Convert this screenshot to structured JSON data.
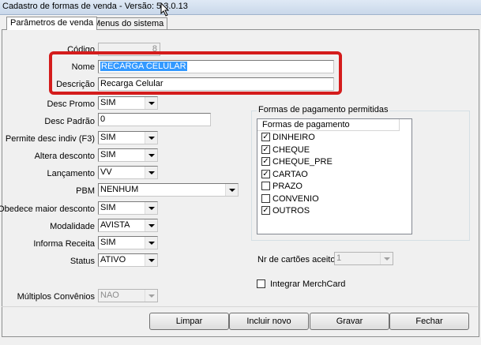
{
  "window": {
    "title": "Cadastro de formas de venda - Versão: 5.3.0.13"
  },
  "tabs": [
    {
      "label": "Parâmetros de venda",
      "active": true
    },
    {
      "label": "Menus do sistema",
      "active": false
    }
  ],
  "form": {
    "codigo": {
      "label": "Código",
      "value": "8"
    },
    "nome": {
      "label": "Nome",
      "value": "RECARGA CELULAR"
    },
    "descricao": {
      "label": "Descrição",
      "value": "Recarga Celular"
    },
    "desc_promo": {
      "label": "Desc Promo",
      "value": "SIM"
    },
    "desc_padrao": {
      "label": "Desc Padrão",
      "value": "0"
    },
    "permite_desc_indiv": {
      "label": "Permite desc indiv (F3)",
      "value": "SIM"
    },
    "altera_desconto": {
      "label": "Altera desconto",
      "value": "SIM"
    },
    "lancamento": {
      "label": "Lançamento",
      "value": "VV"
    },
    "pbm": {
      "label": "PBM",
      "value": "NENHUM"
    },
    "obedece_maior_desconto": {
      "label": "Obedece maior desconto",
      "value": "SIM"
    },
    "modalidade": {
      "label": "Modalidade",
      "value": "AVISTA"
    },
    "informa_receita": {
      "label": "Informa Receita",
      "value": "SIM"
    },
    "status": {
      "label": "Status",
      "value": "ATIVO"
    },
    "multiplos_convenios": {
      "label": "Múltiplos Convênios",
      "value": "NAO"
    }
  },
  "payments": {
    "group_title": "Formas de pagamento permitidas",
    "column_header": "Formas de pagamento",
    "items": [
      {
        "label": "DINHEIRO",
        "checked": true
      },
      {
        "label": "CHEQUE",
        "checked": true
      },
      {
        "label": "CHEQUE_PRE",
        "checked": true
      },
      {
        "label": "CARTAO",
        "checked": true
      },
      {
        "label": "PRAZO",
        "checked": false
      },
      {
        "label": "CONVENIO",
        "checked": false
      },
      {
        "label": "OUTROS",
        "checked": true
      }
    ]
  },
  "nr_cartoes": {
    "label": "Nr de cartões aceitos",
    "value": "1"
  },
  "merchcard": {
    "label": "Integrar MerchCard",
    "checked": false
  },
  "buttons": {
    "limpar": "Limpar",
    "incluir": "Incluir novo",
    "gravar": "Gravar",
    "fechar": "Fechar"
  },
  "colors": {
    "highlight_box": "#d41c1c",
    "selection": "#3399ff"
  }
}
